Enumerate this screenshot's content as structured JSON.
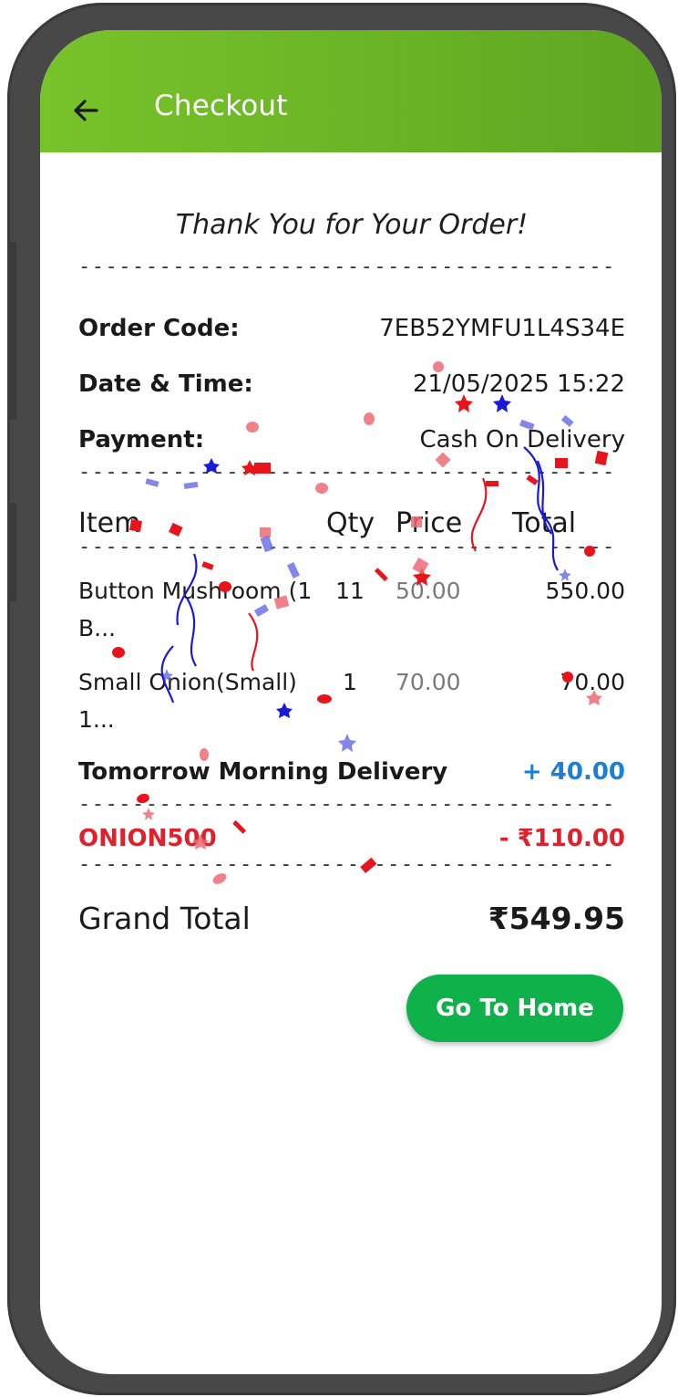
{
  "appbar": {
    "title": "Checkout",
    "back_icon": "arrow-left-icon",
    "color": "#6bb626"
  },
  "receipt": {
    "heading": "Thank You for Your Order!",
    "divider": "----------------------------------------",
    "order_code_label": "Order Code:",
    "order_code": "7EB52YMFU1L4S34E",
    "date_label": "Date & Time:",
    "date_value": "21/05/2025 15:22",
    "payment_label": "Payment:",
    "payment_value": "Cash On Delivery"
  },
  "table": {
    "headers": {
      "item": "Item",
      "qty": "Qty",
      "price": "Price",
      "total": "Total"
    },
    "rows": [
      {
        "name": "Button Mushroom (1 B...",
        "qty": "11",
        "price": "50.00",
        "total": "550.00"
      },
      {
        "name": "Small Onion(Small) 1...",
        "qty": "1",
        "price": "70.00",
        "total": "70.00"
      }
    ]
  },
  "delivery": {
    "label": "Tomorrow Morning Delivery",
    "amount": "+ 40.00",
    "color": "#1b7fd4"
  },
  "coupon": {
    "code": "ONION500",
    "amount": "- ₹110.00",
    "color": "#e0202b"
  },
  "grand_total": {
    "label": "Grand Total",
    "amount": "₹549.95"
  },
  "actions": {
    "home_button": "Go To Home",
    "color": "#0eb14a"
  }
}
